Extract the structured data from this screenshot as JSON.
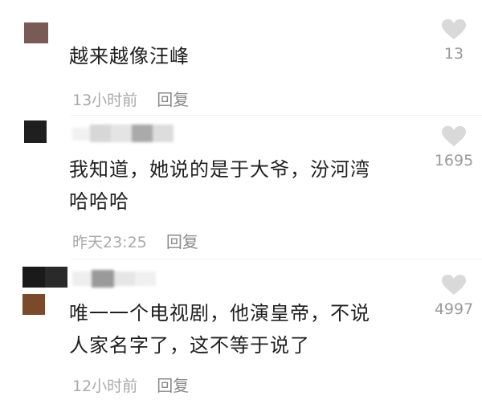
{
  "comments": [
    {
      "text_lines": [
        "越来越像汪峰"
      ],
      "time": "13小时前",
      "reply": "回复",
      "likes": "13",
      "avatar_color": "#7a5a55"
    },
    {
      "text_lines": [
        "我知道，她说的是于大爷，汾河湾",
        "哈哈哈"
      ],
      "time": "昨天23:25",
      "reply": "回复",
      "likes": "1695",
      "avatar_color": "#1f1f1f"
    },
    {
      "text_lines": [
        "唯一一个电视剧，他演皇帝，不说",
        "人家名字了，这不等于说了"
      ],
      "time": "12小时前",
      "reply": "回复",
      "likes": "4997",
      "avatar_color": "#1a1a1a",
      "avatar_color_2": "#7a4a2a"
    }
  ],
  "icons": {
    "like": "heart-icon"
  },
  "colors": {
    "heart": "#d9d9d9",
    "meta": "#a9a9a9"
  }
}
